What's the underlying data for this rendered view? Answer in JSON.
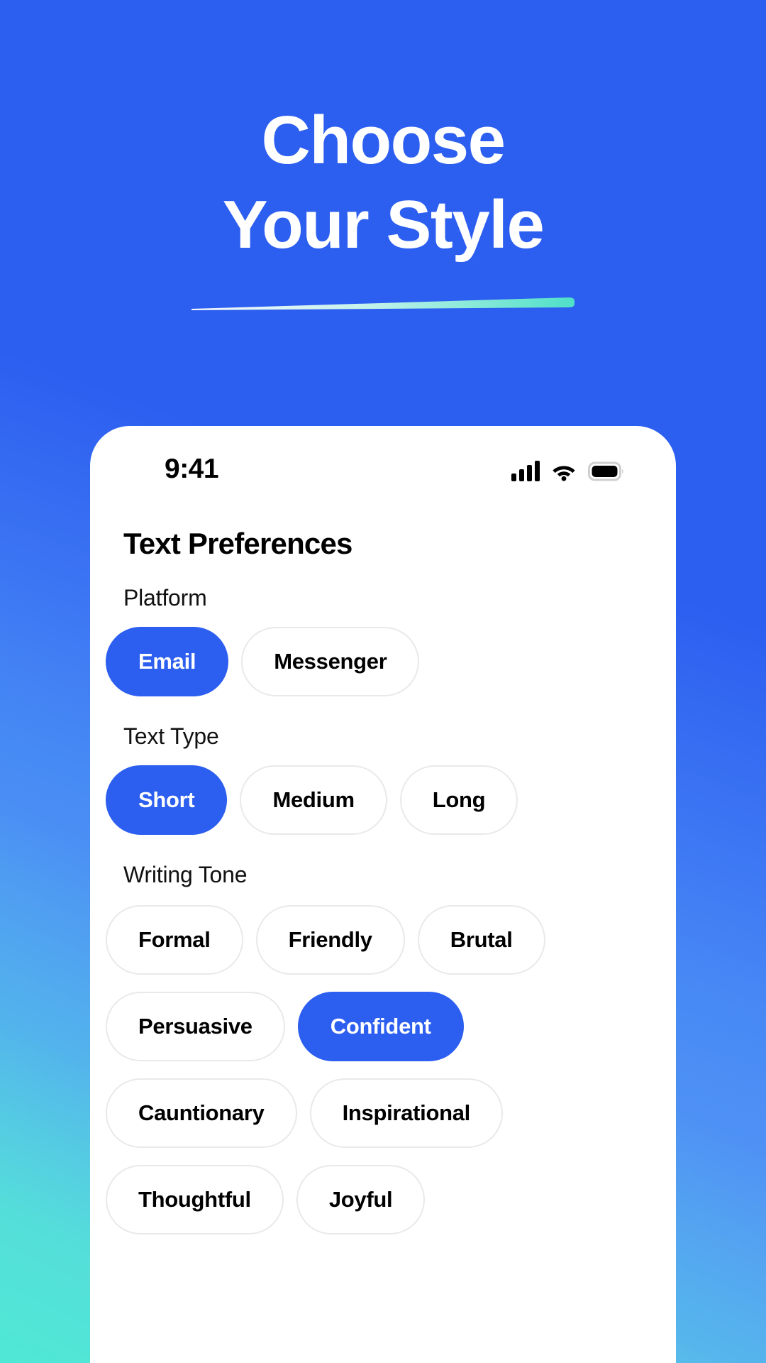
{
  "hero": {
    "title_line1": "Choose",
    "title_line2": "Your Style",
    "accent_color": "#4fe0c8"
  },
  "status_bar": {
    "time": "9:41",
    "signal_icon": "cellular-signal-icon",
    "wifi_icon": "wifi-icon",
    "battery_icon": "battery-full-icon"
  },
  "screen": {
    "title": "Text Preferences",
    "theme": {
      "selected_chip_bg": "#2c5ef0",
      "selected_chip_text": "#ffffff",
      "chip_border": "#e9e9ea",
      "chip_text": "#000000"
    },
    "groups": [
      {
        "label": "Platform",
        "options": [
          {
            "label": "Email",
            "selected": true
          },
          {
            "label": "Messenger",
            "selected": false
          }
        ]
      },
      {
        "label": "Text Type",
        "options": [
          {
            "label": "Short",
            "selected": true
          },
          {
            "label": "Medium",
            "selected": false
          },
          {
            "label": "Long",
            "selected": false
          }
        ]
      },
      {
        "label": "Writing Tone",
        "options": [
          {
            "label": "Formal",
            "selected": false
          },
          {
            "label": "Friendly",
            "selected": false
          },
          {
            "label": "Brutal",
            "selected": false
          },
          {
            "label": "Persuasive",
            "selected": false
          },
          {
            "label": "Confident",
            "selected": true
          },
          {
            "label": "Cauntionary",
            "selected": false
          },
          {
            "label": "Inspirational",
            "selected": false
          },
          {
            "label": "Thoughtful",
            "selected": false
          },
          {
            "label": "Joyful",
            "selected": false
          }
        ]
      }
    ]
  }
}
